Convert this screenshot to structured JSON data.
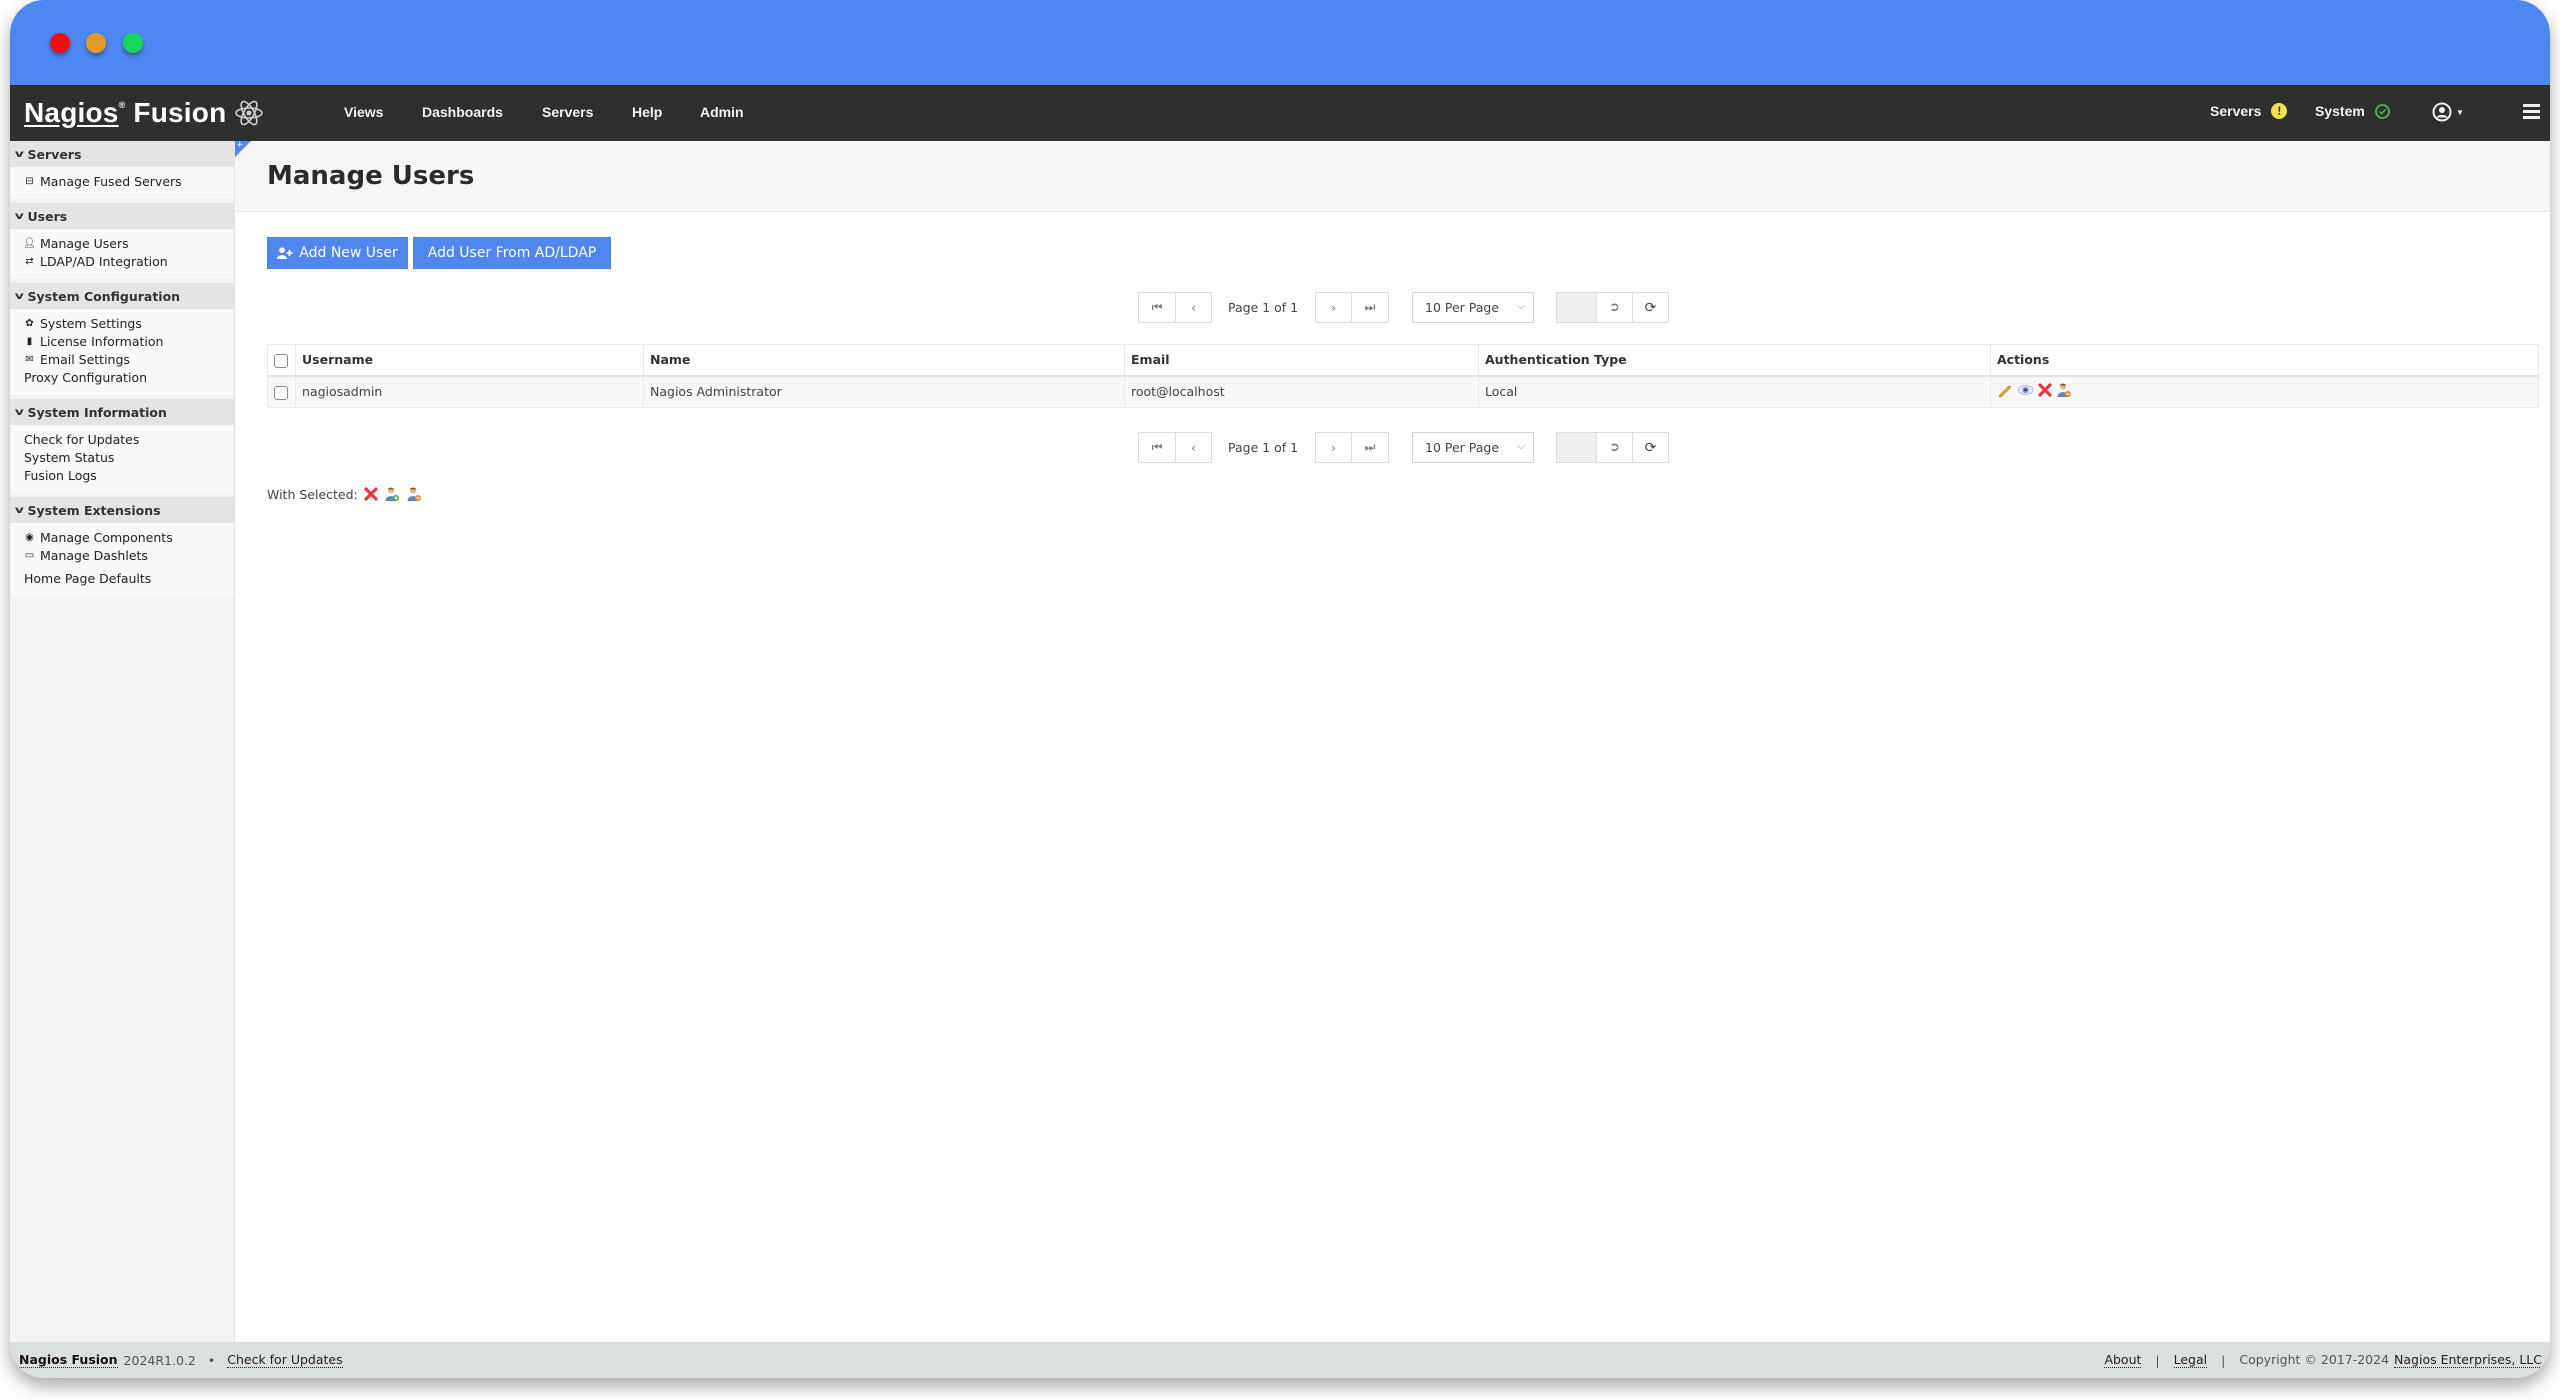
{
  "window": {
    "traffic_lights": [
      "close",
      "minimize",
      "maximize"
    ]
  },
  "topnav": {
    "logo_text": "Nagios",
    "logo_text_2": "Fusion",
    "logo_reg": "®",
    "logo_icon": "atom-icon",
    "items": [
      {
        "label": "Views"
      },
      {
        "label": "Dashboards"
      },
      {
        "label": "Servers"
      },
      {
        "label": "Help"
      },
      {
        "label": "Admin"
      }
    ],
    "status": [
      {
        "label": "Servers",
        "state": "warning",
        "icon": "exclamation-circle-icon",
        "color": "#f3e04a"
      },
      {
        "label": "System",
        "state": "ok",
        "icon": "check-circle-icon",
        "color": "#4cae4c"
      }
    ],
    "user_icon": "user-circle-icon",
    "menu_icon": "hamburger-icon"
  },
  "sidebar": {
    "sections": [
      {
        "title": "Servers",
        "items": [
          {
            "label": "Manage Fused Servers",
            "icon": "server-icon"
          }
        ]
      },
      {
        "title": "Users",
        "items": [
          {
            "label": "Manage Users",
            "icon": "user-icon"
          },
          {
            "label": "LDAP/AD Integration",
            "icon": "exchange-icon"
          }
        ]
      },
      {
        "title": "System Configuration",
        "items": [
          {
            "label": "System Settings",
            "icon": "gear-icon"
          },
          {
            "label": "License Information",
            "icon": "bookmark-icon"
          },
          {
            "label": "Email Settings",
            "icon": "envelope-icon"
          },
          {
            "label": "Proxy Configuration",
            "icon": ""
          }
        ]
      },
      {
        "title": "System Information",
        "items": [
          {
            "label": "Check for Updates",
            "icon": ""
          },
          {
            "label": "System Status",
            "icon": ""
          },
          {
            "label": "Fusion Logs",
            "icon": ""
          }
        ]
      },
      {
        "title": "System Extensions",
        "items": [
          {
            "label": "Manage Components",
            "icon": "cube-icon"
          },
          {
            "label": "Manage Dashlets",
            "icon": "folder-icon"
          },
          {
            "label": "Home Page Defaults",
            "icon": ""
          }
        ]
      }
    ]
  },
  "main": {
    "title": "Manage Users",
    "buttons": {
      "add_new_user": "Add New User",
      "add_from_ldap": "Add User From AD/LDAP"
    },
    "pagination": {
      "page_text": "Page 1 of 1",
      "per_page": "10 Per Page",
      "page_input_value": ""
    },
    "table": {
      "columns": [
        "Username",
        "Name",
        "Email",
        "Authentication Type",
        "Actions"
      ],
      "rows": [
        {
          "username": "nagiosadmin",
          "name": "Nagios Administrator",
          "email": "root@localhost",
          "auth_type": "Local",
          "actions": [
            "edit-icon",
            "view-icon",
            "delete-icon",
            "masquerade-icon"
          ]
        }
      ]
    },
    "with_selected": {
      "label": "With Selected:",
      "actions": [
        "delete-icon",
        "user-enable-icon",
        "user-disable-icon"
      ]
    }
  },
  "footer": {
    "product": "Nagios Fusion",
    "version": "2024R1.0.2",
    "separator": "•",
    "check_updates": "Check for Updates",
    "about": "About",
    "legal": "Legal",
    "pipe": "|",
    "copyright": "Copyright © 2017-2024",
    "company": "Nagios Enterprises, LLC"
  }
}
